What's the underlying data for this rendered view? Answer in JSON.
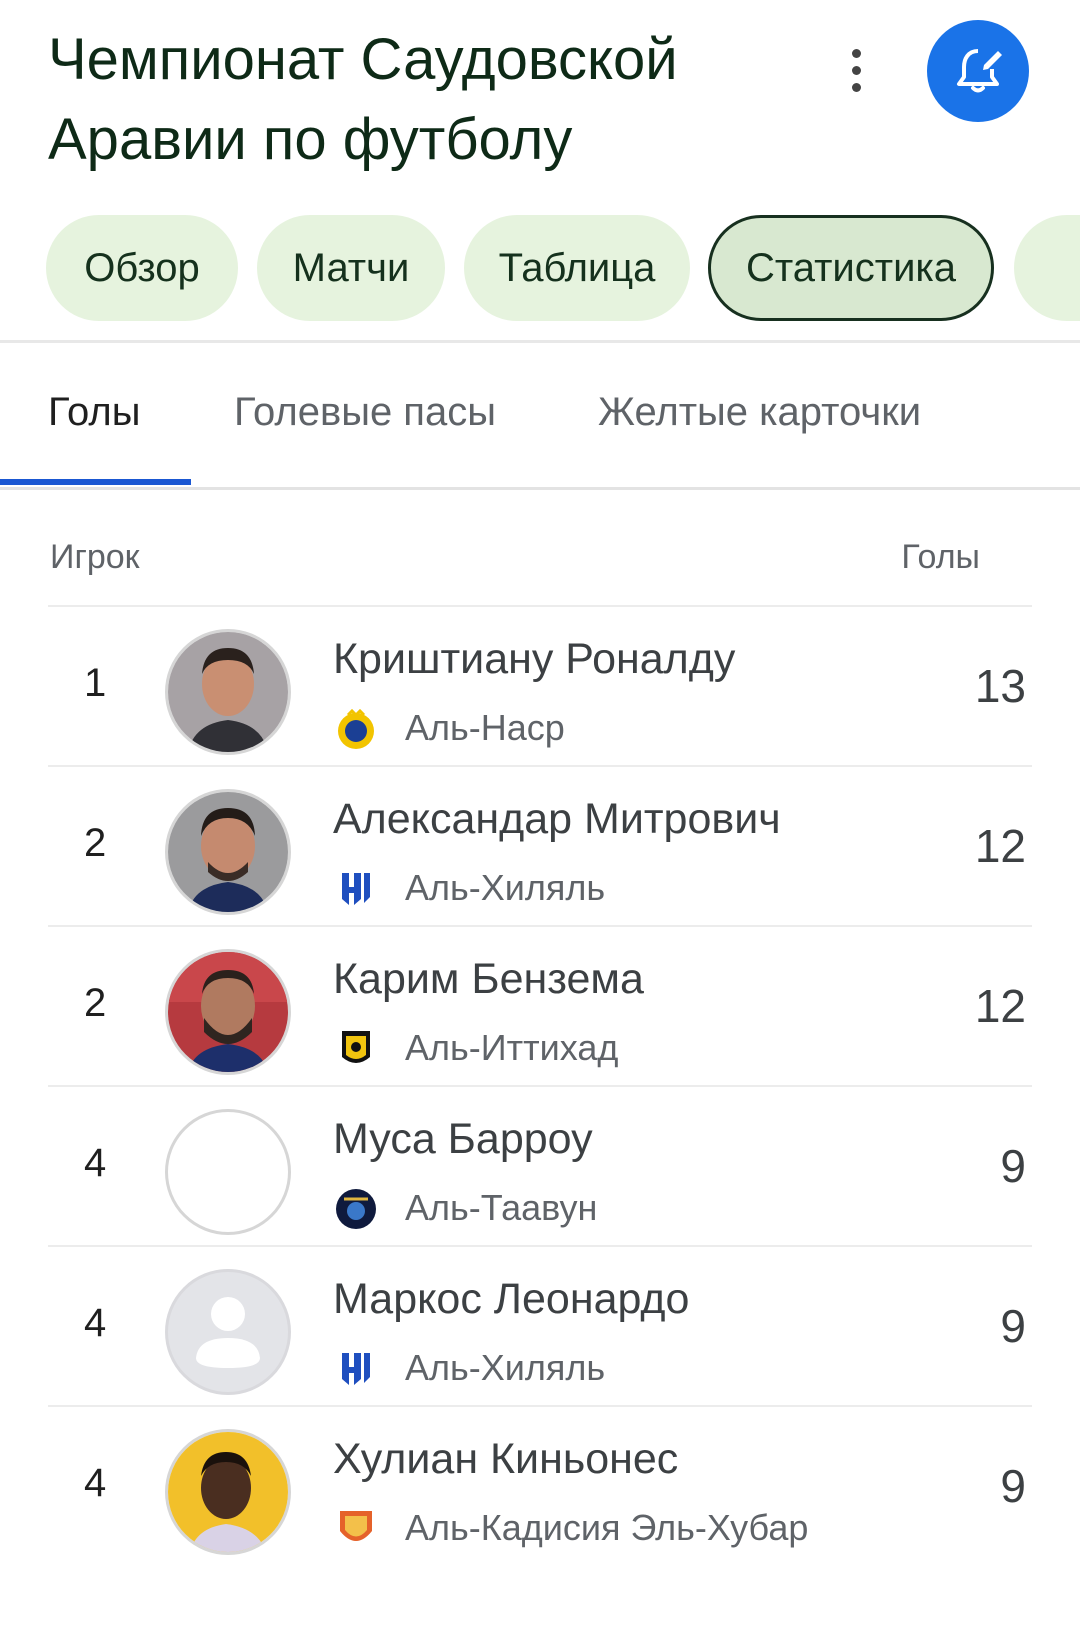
{
  "header": {
    "title": "Чемпионат Саудовской Аравии по футболу",
    "more_icon": "more-vert-icon",
    "bell_icon": "bell-edit-icon",
    "accent": "#1a73e8"
  },
  "chips": [
    {
      "label": "Обзор",
      "active": false
    },
    {
      "label": "Матчи",
      "active": false
    },
    {
      "label": "Таблица",
      "active": false
    },
    {
      "label": "Статистика",
      "active": true
    }
  ],
  "tabs": [
    {
      "label": "Голы",
      "active": true
    },
    {
      "label": "Голевые пасы",
      "active": false
    },
    {
      "label": "Желтые карточки",
      "active": false
    }
  ],
  "table": {
    "col_player": "Игрок",
    "col_goals": "Голы",
    "rows": [
      {
        "rank": "1",
        "name": "Криштиану Роналду",
        "team": "Аль-Наср",
        "goals": "13",
        "team_logo": "al-nassr-logo",
        "avatar": "player-photo"
      },
      {
        "rank": "2",
        "name": "Александар Митрович",
        "team": "Аль-Хиляль",
        "goals": "12",
        "team_logo": "al-hilal-logo",
        "avatar": "player-photo"
      },
      {
        "rank": "2",
        "name": "Карим Бензема",
        "team": "Аль-Иттихад",
        "goals": "12",
        "team_logo": "al-ittihad-logo",
        "avatar": "player-photo"
      },
      {
        "rank": "4",
        "name": "Муса Барроу",
        "team": "Аль-Таавун",
        "goals": "9",
        "team_logo": "al-taawoun-logo",
        "avatar": "empty"
      },
      {
        "rank": "4",
        "name": "Маркос Леонардо",
        "team": "Аль-Хиляль",
        "goals": "9",
        "team_logo": "al-hilal-logo",
        "avatar": "placeholder-person"
      },
      {
        "rank": "4",
        "name": "Хулиан Киньонес",
        "team": "Аль-Кадисия Эль-Хубар",
        "goals": "9",
        "team_logo": "al-qadsiah-logo",
        "avatar": "player-photo"
      }
    ]
  }
}
